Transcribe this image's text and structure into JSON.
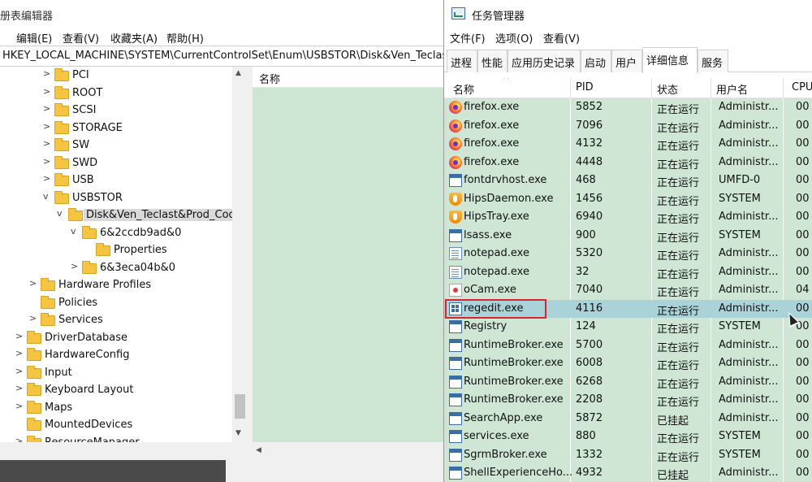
{
  "regedit": {
    "title": "册表编辑器",
    "menu": [
      "编辑(E)",
      "查看(V)",
      "收藏夹(A)",
      "帮助(H)"
    ],
    "address": "HKEY_LOCAL_MACHINE\\SYSTEM\\CurrentControlSet\\Enum\\USBSTOR\\Disk&Ven_Teclast",
    "tree": [
      {
        "label": "PCI",
        "expander": ">"
      },
      {
        "label": "ROOT",
        "expander": ">"
      },
      {
        "label": "SCSI",
        "expander": ">"
      },
      {
        "label": "STORAGE",
        "expander": ">"
      },
      {
        "label": "SW",
        "expander": ">"
      },
      {
        "label": "SWD",
        "expander": ">"
      },
      {
        "label": "USB",
        "expander": ">"
      },
      {
        "label": "USBSTOR",
        "expander": "v"
      },
      {
        "label": "Disk&Ven_Teclast&Prod_Coo",
        "expander": "v"
      },
      {
        "label": "6&2ccdb9ad&0",
        "expander": "v"
      },
      {
        "label": "Properties",
        "expander": ""
      },
      {
        "label": "6&3eca04b&0",
        "expander": ">"
      },
      {
        "label": "Hardware Profiles",
        "expander": ">"
      },
      {
        "label": "Policies",
        "expander": ""
      },
      {
        "label": "Services",
        "expander": ">"
      },
      {
        "label": "DriverDatabase",
        "expander": ">"
      },
      {
        "label": "HardwareConfig",
        "expander": ">"
      },
      {
        "label": "Input",
        "expander": ">"
      },
      {
        "label": "Keyboard Layout",
        "expander": ">"
      },
      {
        "label": "Maps",
        "expander": ">"
      },
      {
        "label": "MountedDevices",
        "expander": ""
      },
      {
        "label": "ResourceManager",
        "expander": ">"
      }
    ],
    "list_header": "名称"
  },
  "taskmgr": {
    "title": "任务管理器",
    "menu": [
      "文件(F)",
      "选项(O)",
      "查看(V)"
    ],
    "tabs": [
      "进程",
      "性能",
      "应用历史记录",
      "启动",
      "用户",
      "详细信息",
      "服务"
    ],
    "active_tab": "详细信息",
    "columns": [
      "名称",
      "PID",
      "状态",
      "用户名",
      "CPU"
    ],
    "rows": [
      {
        "name": "firefox.exe",
        "pid": "5852",
        "status": "正在运行",
        "user": "Administr...",
        "cpu": "00",
        "icon": "firefox-icon"
      },
      {
        "name": "firefox.exe",
        "pid": "7096",
        "status": "正在运行",
        "user": "Administr...",
        "cpu": "00",
        "icon": "firefox-icon"
      },
      {
        "name": "firefox.exe",
        "pid": "4132",
        "status": "正在运行",
        "user": "Administr...",
        "cpu": "00",
        "icon": "firefox-icon"
      },
      {
        "name": "firefox.exe",
        "pid": "4448",
        "status": "正在运行",
        "user": "Administr...",
        "cpu": "00",
        "icon": "firefox-icon"
      },
      {
        "name": "fontdrvhost.exe",
        "pid": "468",
        "status": "正在运行",
        "user": "UMFD-0",
        "cpu": "00",
        "icon": "window-icon"
      },
      {
        "name": "HipsDaemon.exe",
        "pid": "1456",
        "status": "正在运行",
        "user": "SYSTEM",
        "cpu": "00",
        "icon": "shield-icon"
      },
      {
        "name": "HipsTray.exe",
        "pid": "6940",
        "status": "正在运行",
        "user": "Administr...",
        "cpu": "00",
        "icon": "shield-icon"
      },
      {
        "name": "lsass.exe",
        "pid": "900",
        "status": "正在运行",
        "user": "SYSTEM",
        "cpu": "00",
        "icon": "window-icon"
      },
      {
        "name": "notepad.exe",
        "pid": "5320",
        "status": "正在运行",
        "user": "Administr...",
        "cpu": "00",
        "icon": "notepad-icon"
      },
      {
        "name": "notepad.exe",
        "pid": "32",
        "status": "正在运行",
        "user": "Administr...",
        "cpu": "00",
        "icon": "notepad-icon"
      },
      {
        "name": "oCam.exe",
        "pid": "7040",
        "status": "正在运行",
        "user": "Administr...",
        "cpu": "04",
        "icon": "ocam-icon"
      },
      {
        "name": "regedit.exe",
        "pid": "4116",
        "status": "正在运行",
        "user": "Administr...",
        "cpu": "00",
        "icon": "regedit-icon",
        "selected": true
      },
      {
        "name": "Registry",
        "pid": "124",
        "status": "正在运行",
        "user": "SYSTEM",
        "cpu": "00",
        "icon": "window-icon"
      },
      {
        "name": "RuntimeBroker.exe",
        "pid": "5700",
        "status": "正在运行",
        "user": "Administr...",
        "cpu": "00",
        "icon": "window-icon"
      },
      {
        "name": "RuntimeBroker.exe",
        "pid": "6008",
        "status": "正在运行",
        "user": "Administr...",
        "cpu": "00",
        "icon": "window-icon"
      },
      {
        "name": "RuntimeBroker.exe",
        "pid": "6268",
        "status": "正在运行",
        "user": "Administr...",
        "cpu": "00",
        "icon": "window-icon"
      },
      {
        "name": "RuntimeBroker.exe",
        "pid": "2208",
        "status": "正在运行",
        "user": "Administr...",
        "cpu": "00",
        "icon": "window-icon"
      },
      {
        "name": "SearchApp.exe",
        "pid": "5872",
        "status": "已挂起",
        "user": "Administr...",
        "cpu": "00",
        "icon": "window-icon"
      },
      {
        "name": "services.exe",
        "pid": "880",
        "status": "正在运行",
        "user": "SYSTEM",
        "cpu": "00",
        "icon": "window-icon"
      },
      {
        "name": "SgrmBroker.exe",
        "pid": "1332",
        "status": "正在运行",
        "user": "SYSTEM",
        "cpu": "00",
        "icon": "window-icon"
      },
      {
        "name": "ShellExperienceHo...",
        "pid": "4932",
        "status": "已挂起",
        "user": "Administr...",
        "cpu": "00",
        "icon": "window-icon"
      }
    ]
  }
}
